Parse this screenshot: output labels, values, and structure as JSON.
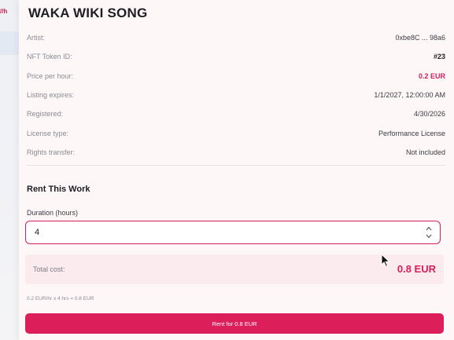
{
  "background": {
    "tag": "//h"
  },
  "song": {
    "title": "WAKA WIKI SONG"
  },
  "details": [
    {
      "label": "Artist:",
      "value": "0xbe8C ... 98a6",
      "style": "normal"
    },
    {
      "label": "NFT Token ID:",
      "value": "#23",
      "style": "bold"
    },
    {
      "label": "Price per hour:",
      "value": "0.2 EUR",
      "style": "accent"
    },
    {
      "label": "Listing expires:",
      "value": "1/1/2027, 12:00:00 AM",
      "style": "normal"
    },
    {
      "label": "Registered:",
      "value": "4/30/2026",
      "style": "normal"
    },
    {
      "label": "License type:",
      "value": "Performance License",
      "style": "normal"
    },
    {
      "label": "Rights transfer:",
      "value": "Not included",
      "style": "normal"
    }
  ],
  "rent": {
    "heading": "Rent This Work",
    "duration_label": "Duration (hours)",
    "duration_value": "4",
    "total_label": "Total cost:",
    "total_value": "0.8 EUR",
    "formula": "0.2 EUR/hr x 4 hrs = 0.8 EUR",
    "button_label": "Rent for 0.8 EUR"
  },
  "colors": {
    "accent": "#d81e5b",
    "card_background": "#fdf7f8",
    "total_background": "#fcebee"
  },
  "icons": {
    "stepper": "chevron-up-down-icon",
    "cursor": "mouse-pointer-icon"
  }
}
